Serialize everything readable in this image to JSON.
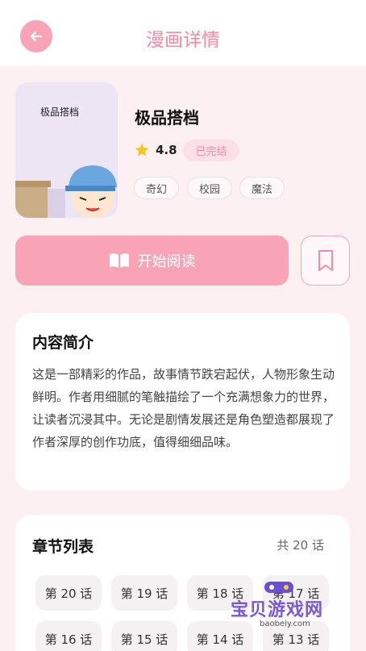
{
  "header": {
    "title": "漫画详情",
    "back_icon": "arrow-left-icon"
  },
  "manga": {
    "cover_title": "极品搭档",
    "name": "极品搭档",
    "rating": "4.8",
    "status": "已完结",
    "tags": [
      "奇幻",
      "校园",
      "魔法"
    ]
  },
  "actions": {
    "read_label": "开始阅读",
    "read_icon": "book-open-icon",
    "bookmark_icon": "bookmark-icon"
  },
  "intro": {
    "title": "内容简介",
    "text": "这是一部精彩的作品，故事情节跌宕起伏，人物形象生动鲜明。作者用细腻的笔触描绘了一个充满想象力的世界，让读者沉浸其中。无论是剧情发展还是角色塑造都展现了作者深厚的创作功底，值得细细品味。"
  },
  "chapters": {
    "title": "章节列表",
    "count": "共 20 话",
    "items": [
      "第 20 话",
      "第 19 话",
      "第 18 话",
      "第 17 话",
      "第 16 话",
      "第 15 话",
      "第 14 话",
      "第 13 话"
    ]
  },
  "watermark": {
    "text": "宝贝游戏网",
    "url": "baobeiy.com"
  },
  "colors": {
    "accent": "#f9a4b6",
    "accent_text": "#f38aa2",
    "background": "#fdf0f3",
    "badge_bg": "#fde0e7"
  }
}
